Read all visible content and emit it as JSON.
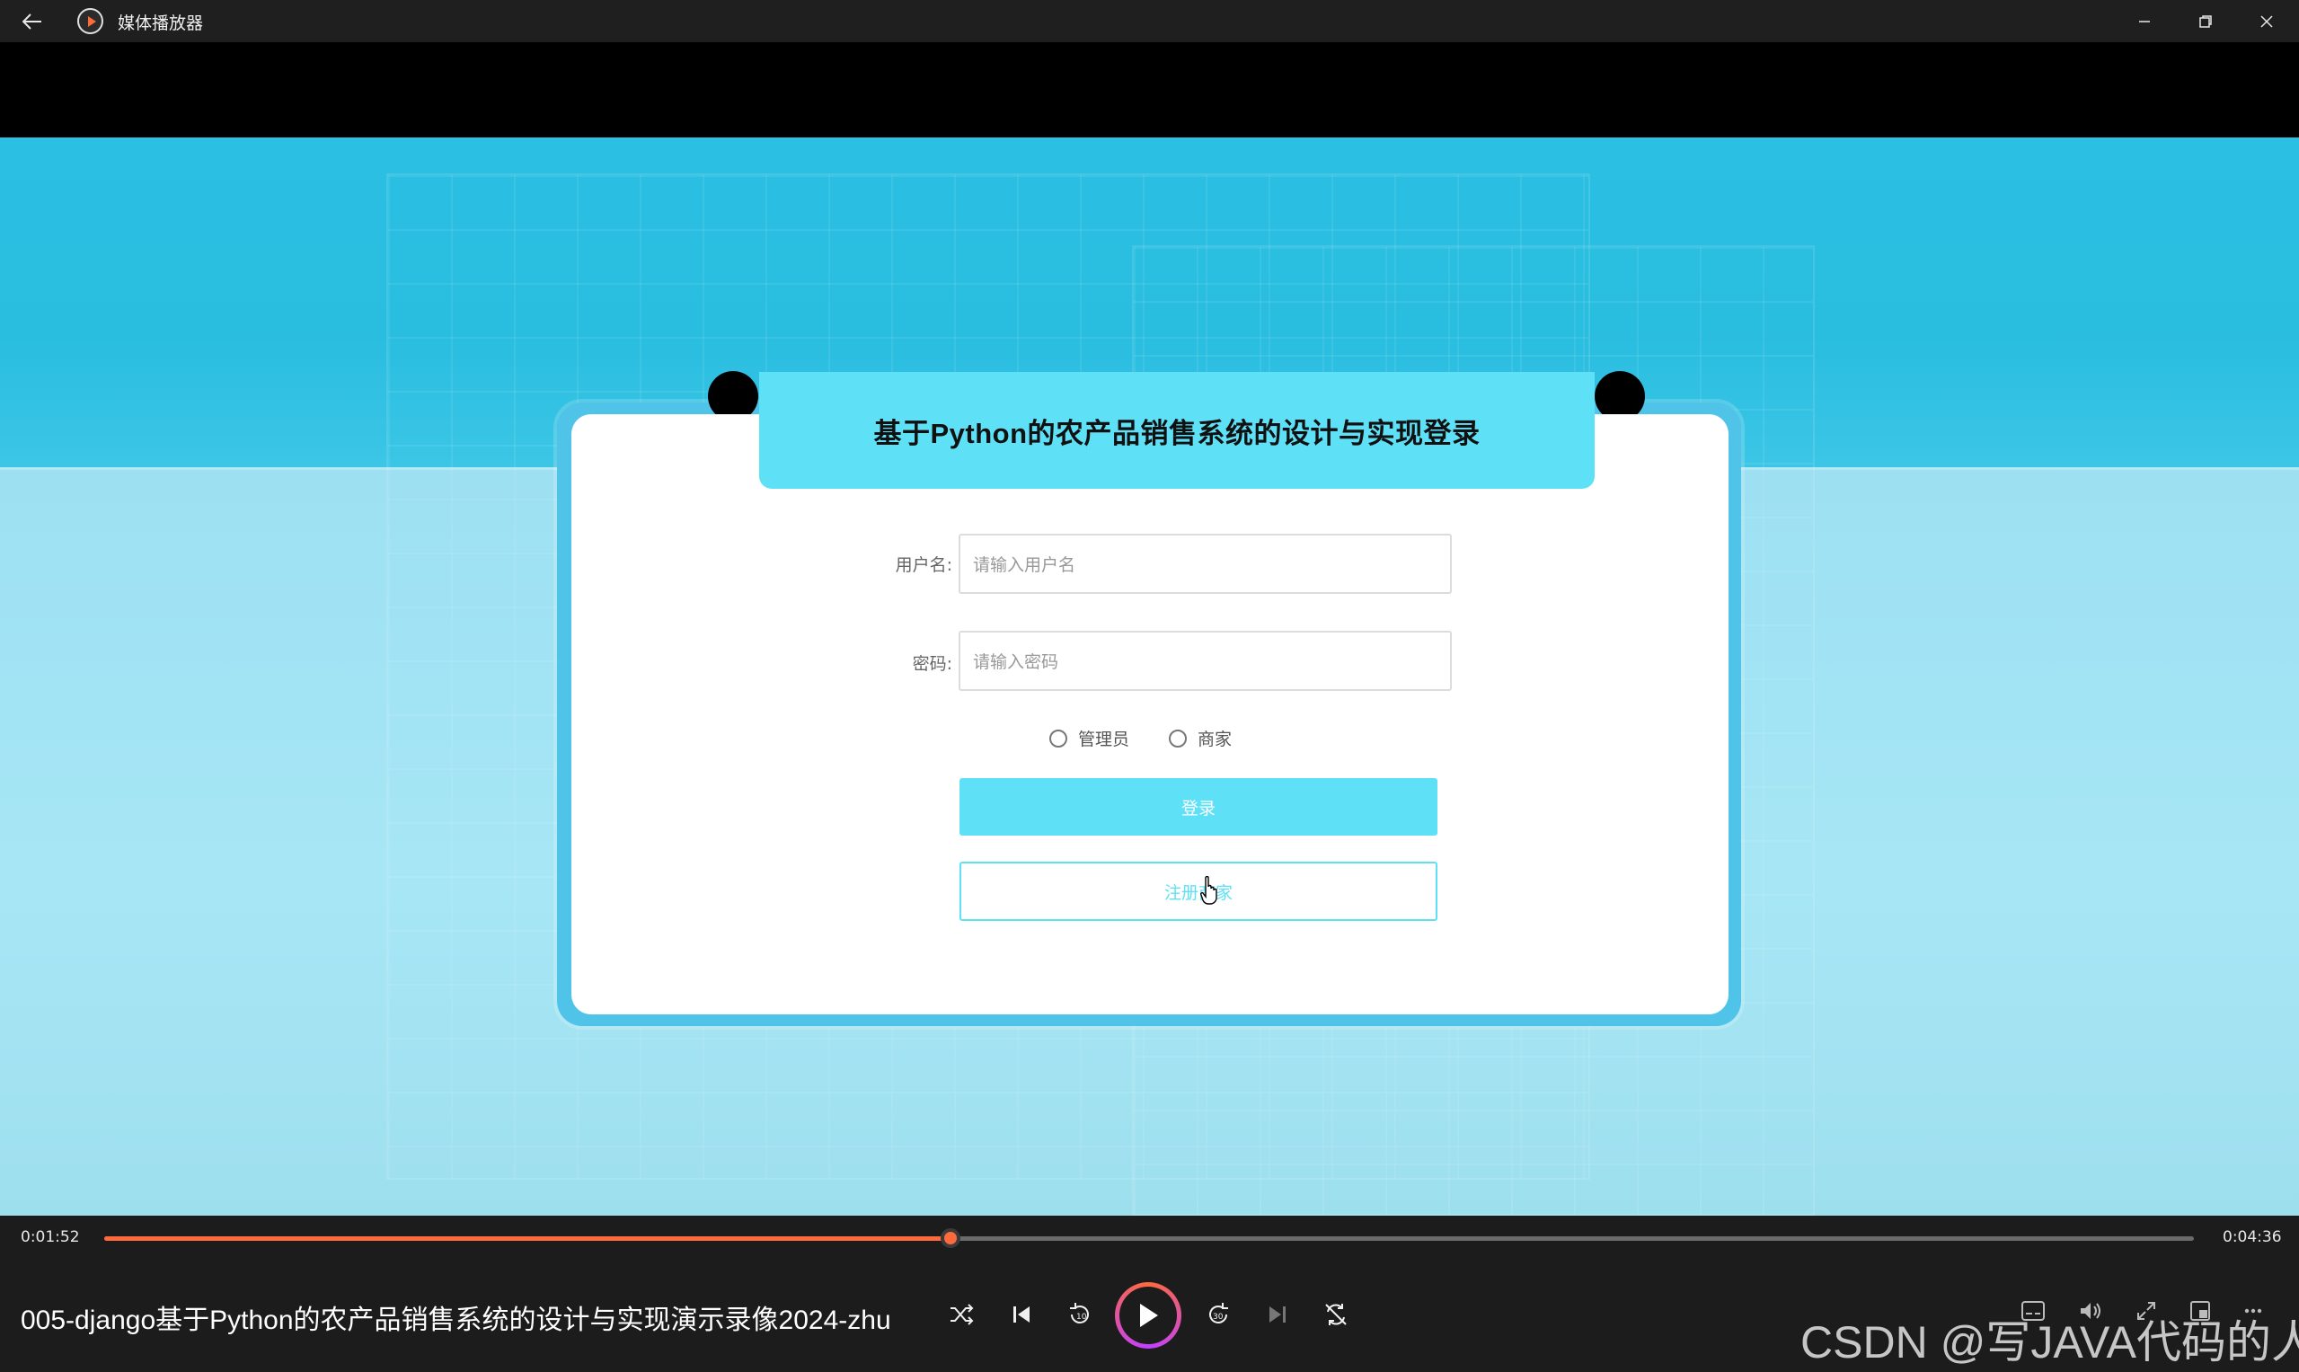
{
  "window": {
    "app_title": "媒体播放器",
    "icons": {
      "back": "back-arrow-icon",
      "app": "media-player-icon",
      "minimize": "minimize-icon",
      "maximize": "restore-icon",
      "close": "close-icon"
    }
  },
  "login_page": {
    "title": "基于Python的农产品销售系统的设计与实现登录",
    "username": {
      "label": "用户名:",
      "placeholder": "请输入用户名"
    },
    "password": {
      "label": "密码:",
      "placeholder": "请输入密码"
    },
    "roles": [
      {
        "label": "管理员",
        "selected": false
      },
      {
        "label": "商家",
        "selected": false
      }
    ],
    "login_button": "登录",
    "register_button": "注册商家",
    "colors": {
      "accent": "#5ee1f7",
      "frame": "#4fc3e8"
    }
  },
  "player": {
    "current_time": "0:01:52",
    "total_time": "0:04:36",
    "progress_fraction": 0.405,
    "media_title": "005-django基于Python的农产品销售系统的设计与实现演示录像2024-zhu",
    "accent_color": "#ff6a3d",
    "controls": [
      "shuffle-icon",
      "previous-icon",
      "rewind-10-icon",
      "play-icon",
      "forward-30-icon",
      "next-icon",
      "repeat-off-icon"
    ],
    "right_controls": [
      "subtitles-icon",
      "volume-icon",
      "fullscreen-icon",
      "mini-player-icon",
      "more-icon"
    ]
  },
  "watermark": "CSDN @写JAVA代码的人"
}
